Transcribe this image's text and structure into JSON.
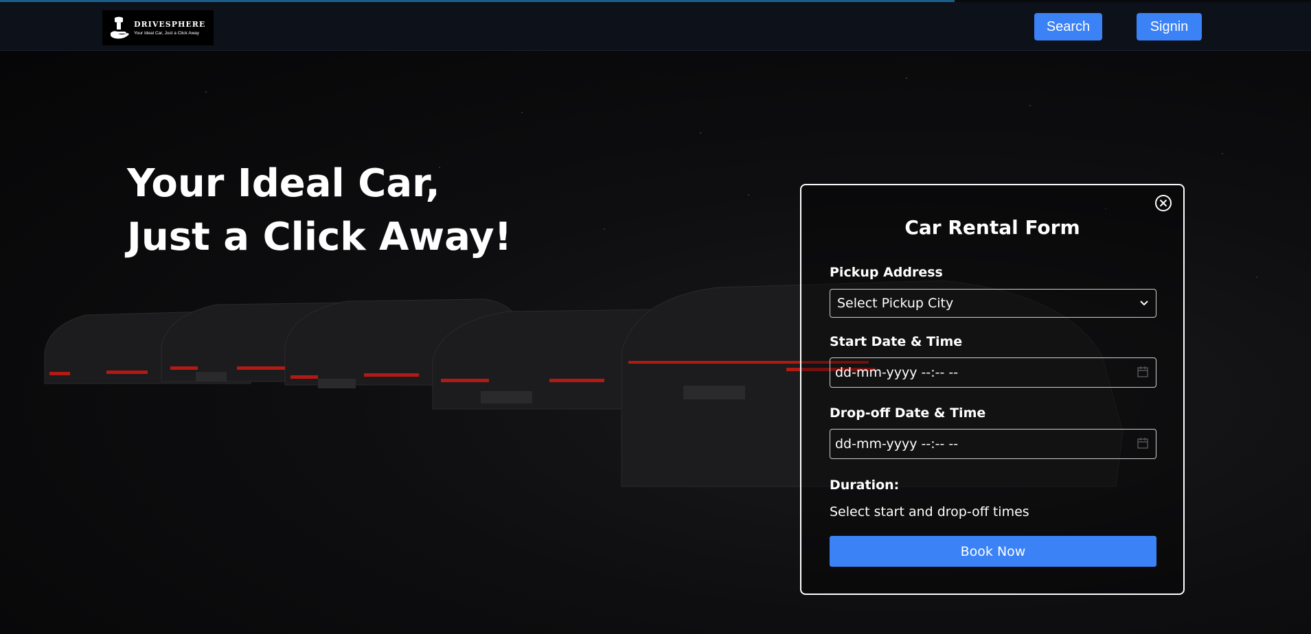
{
  "brand": {
    "name": "DRIVESPHERE",
    "tagline": "Your Ideal Car, Just a Click Away"
  },
  "nav": {
    "search_label": "Search",
    "signin_label": "Signin"
  },
  "hero": {
    "line1": "Your Ideal Car,",
    "line2": "Just a Click Away!"
  },
  "form": {
    "title": "Car Rental Form",
    "pickup_label": "Pickup Address",
    "pickup_value": "Select Pickup City",
    "start_label": "Start Date & Time",
    "start_value": "dd-mm-yyyy --:-- --",
    "dropoff_label": "Drop-off Date & Time",
    "dropoff_value": "dd-mm-yyyy --:-- --",
    "duration_label": "Duration:",
    "duration_text": "Select start and drop-off times",
    "book_label": "Book Now"
  },
  "colors": {
    "accent": "#3b82f6",
    "navbar": "#0c111a",
    "background": "#0a0a0c"
  },
  "icons": {
    "close": "circle-x-icon",
    "dropdown": "chevron-down-icon",
    "calendar": "calendar-icon"
  }
}
